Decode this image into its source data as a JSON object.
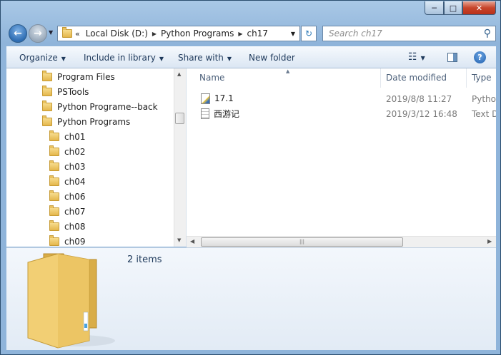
{
  "titlebar": {
    "minimize_glyph": "─",
    "maximize_glyph": "□",
    "close_glyph": "✕"
  },
  "nav": {
    "back_glyph": "←",
    "forward_glyph": "→",
    "dropdown_glyph": "▼"
  },
  "address": {
    "overflow": "«",
    "crumbs": [
      "Local Disk (D:)",
      "Python Programs",
      "ch17"
    ],
    "separator": "▶",
    "dropdown_glyph": "▼",
    "refresh_glyph": "↻"
  },
  "search": {
    "placeholder": "Search ch17",
    "icon_glyph": "⚲"
  },
  "toolbar": {
    "organize": "Organize",
    "include_in_library": "Include in library",
    "share_with": "Share with",
    "new_folder": "New folder",
    "dropdown_glyph": "▼",
    "view_glyph": "☷",
    "help_glyph": "?"
  },
  "tree": {
    "items": [
      {
        "label": "Program Files"
      },
      {
        "label": "PSTools"
      },
      {
        "label": "Python Programe--back"
      },
      {
        "label": "Python Programs"
      },
      {
        "label": "ch01"
      },
      {
        "label": "ch02"
      },
      {
        "label": "ch03"
      },
      {
        "label": "ch04"
      },
      {
        "label": "ch06"
      },
      {
        "label": "ch07"
      },
      {
        "label": "ch08"
      },
      {
        "label": "ch09"
      }
    ],
    "scroll_up_glyph": "▲",
    "scroll_down_glyph": "▼"
  },
  "files": {
    "columns": {
      "name": "Name",
      "date_modified": "Date modified",
      "type": "Type"
    },
    "sort_glyph": "▲",
    "rows": [
      {
        "name": "17.1",
        "date": "2019/8/8 11:27",
        "type": "Pytho"
      },
      {
        "name": "西游记",
        "date": "2019/3/12 16:48",
        "type": "Text D"
      }
    ],
    "scroll_left_glyph": "◀",
    "scroll_right_glyph": "▶",
    "scroll_grip_glyph": "|||"
  },
  "details": {
    "item_count": "2 items"
  },
  "colors": {
    "window_frame": "#8fb4da",
    "toolbar_text": "#1e395b",
    "close_button": "#c7452b"
  }
}
